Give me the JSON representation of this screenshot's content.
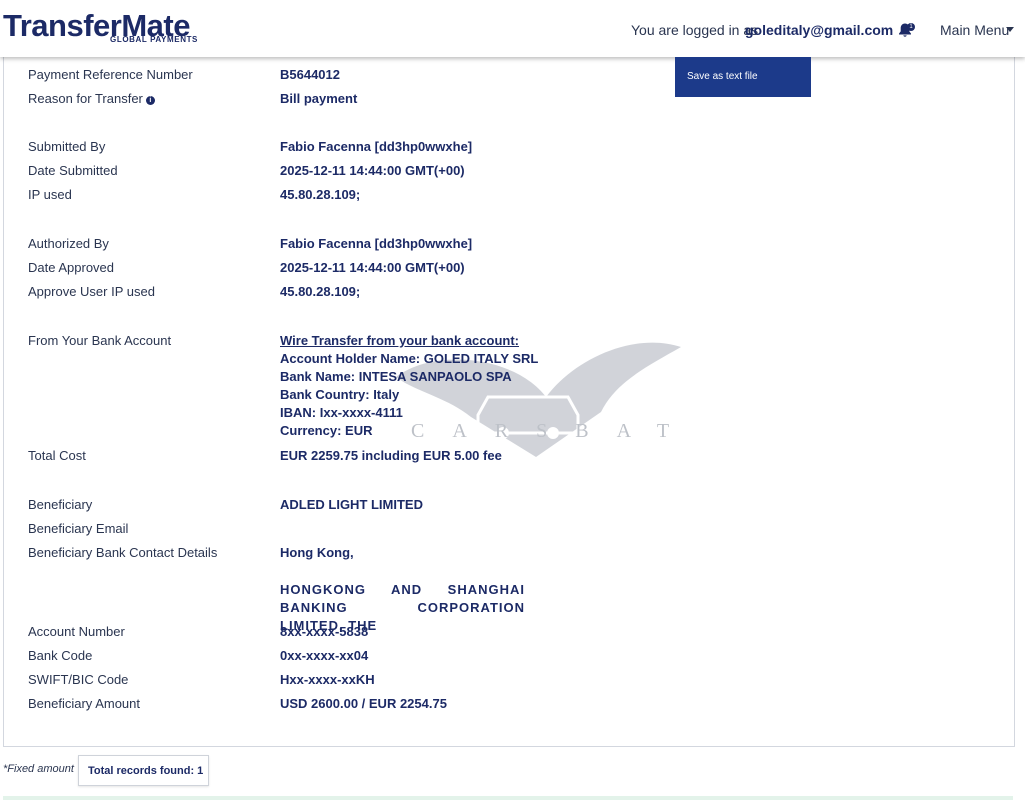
{
  "header": {
    "logo_main": "TransferMate",
    "logo_sub": "GLOBAL PAYMENTS",
    "login_prefix": "You are logged in as",
    "login_email": "goleditaly@gmail.com",
    "notification_count": "1",
    "main_menu_label": "Main Menu"
  },
  "dropdown": {
    "save_text_file": "Save as text file"
  },
  "details": [
    {
      "label": "Payment Reference Number",
      "value": "B5644012"
    },
    {
      "label": "Reason for Transfer",
      "value": "Bill payment"
    },
    {
      "label": "Submitted By",
      "value": "Fabio Facenna [dd3hp0wwxhe]"
    },
    {
      "label": "Date Submitted",
      "value": "2025-12-11 14:44:00 GMT(+00)"
    },
    {
      "label": "IP used",
      "value": "45.80.28.109;"
    },
    {
      "label": "Authorized By",
      "value": "Fabio Facenna [dd3hp0wwxhe]"
    },
    {
      "label": "Date Approved",
      "value": "2025-12-11 14:44:00 GMT(+00)"
    },
    {
      "label": "Approve User IP used",
      "value": "45.80.28.109;"
    },
    {
      "label": "From Your Bank Account",
      "value": ""
    },
    {
      "label": "Total Cost",
      "value": "EUR 2259.75 including EUR 5.00 fee"
    },
    {
      "label": "Beneficiary",
      "value": "ADLED LIGHT LIMITED"
    },
    {
      "label": "Beneficiary Email",
      "value": ""
    },
    {
      "label": "Beneficiary Bank Contact Details",
      "value": "Hong Kong,"
    },
    {
      "label": "Account Number",
      "value": "8xx-xxxx-5838"
    },
    {
      "label": "Bank Code",
      "value": "0xx-xxxx-xx04"
    },
    {
      "label": "SWIFT/BIC Code",
      "value": "Hxx-xxxx-xxKH"
    },
    {
      "label": "Beneficiary Amount",
      "value": "USD 2600.00 / EUR 2254.75"
    }
  ],
  "bank_account": {
    "title": "Wire Transfer from your bank account:",
    "holder_label": "Account Holder Name:",
    "holder_value": "GOLED ITALY SRL",
    "bank_label": "Bank Name:",
    "bank_value": "INTESA SANPAOLO SPA",
    "country_label": "Bank Country:",
    "country_value": "Italy",
    "iban_label": "IBAN:",
    "iban_value": "Ixx-xxxx-4111",
    "currency_label": "Currency:",
    "currency_value": "EUR"
  },
  "beneficiary_bank_name": "HONGKONG AND SHANGHAI BANKING CORPORATION LIMITED, THE",
  "watermark_text": "CARSBAT",
  "footer": {
    "fixed_amount_note": "*Fixed amount",
    "total_records": "Total records found: 1"
  }
}
